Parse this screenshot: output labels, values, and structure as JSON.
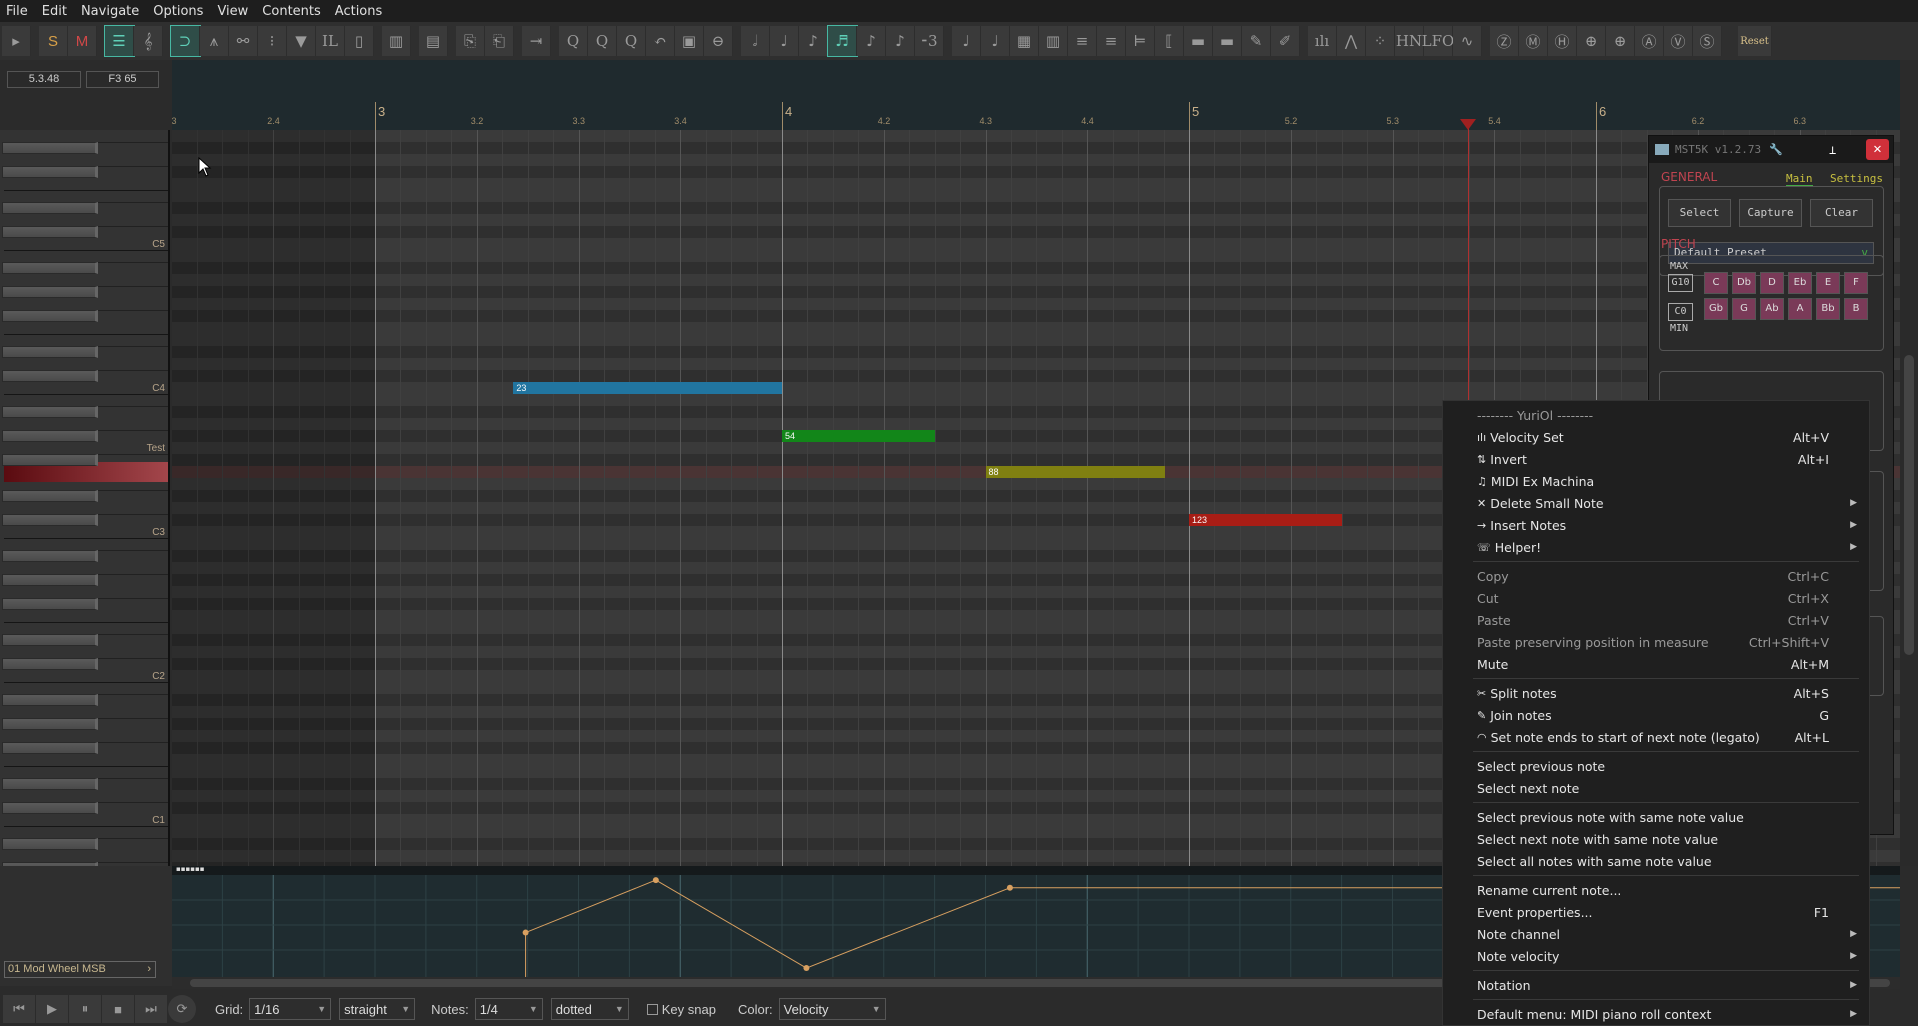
{
  "menubar": [
    "File",
    "Edit",
    "Navigate",
    "Options",
    "View",
    "Contents",
    "Actions"
  ],
  "toolbar": {
    "groups": [
      [
        {
          "icon": "play-arrow-icon",
          "glyph": "▸"
        }
      ],
      [
        {
          "icon": "solo-icon",
          "glyph": "S",
          "cls": "S"
        },
        {
          "icon": "mute-icon",
          "glyph": "M",
          "cls": "M"
        }
      ],
      [
        {
          "icon": "piano-roll-view-icon",
          "glyph": "☰",
          "active": true
        },
        {
          "icon": "treble-clef-icon",
          "glyph": "𝄞"
        }
      ],
      [
        {
          "icon": "snap-magnet-icon",
          "glyph": "⊃",
          "active": true
        },
        {
          "icon": "autoscroll-icon",
          "glyph": "⩚"
        },
        {
          "icon": "link-icon",
          "glyph": "⚯"
        },
        {
          "icon": "footsteps-icon",
          "glyph": "⁝"
        },
        {
          "icon": "filter-icon",
          "glyph": "▼"
        },
        {
          "icon": "IL",
          "glyph": "IL"
        },
        {
          "icon": "velocity-bar-icon",
          "glyph": "▯"
        }
      ],
      [
        {
          "icon": "piano-keys-icon",
          "glyph": "▥"
        }
      ],
      [
        {
          "icon": "cc-lane-icon",
          "glyph": "▤"
        }
      ],
      [
        {
          "icon": "copy-items-icon",
          "glyph": "⎘"
        },
        {
          "icon": "paste-items-icon",
          "glyph": "⎗"
        }
      ],
      [
        {
          "icon": "insert-marker-icon",
          "glyph": "⇥"
        }
      ],
      [
        {
          "icon": "quantize-icon",
          "glyph": "Q"
        },
        {
          "icon": "quantize-settings-icon",
          "glyph": "Q"
        },
        {
          "icon": "unquantize-icon",
          "glyph": "Q"
        },
        {
          "icon": "undo-icon",
          "glyph": "↶"
        },
        {
          "icon": "film-icon",
          "glyph": "▣"
        },
        {
          "icon": "zoom-q-icon",
          "glyph": "⊖"
        }
      ],
      [
        {
          "icon": "half-note-icon",
          "glyph": "𝅗𝅥"
        },
        {
          "icon": "quarter-note-icon",
          "glyph": "♩"
        },
        {
          "icon": "eighth-note-icon",
          "glyph": "♪"
        },
        {
          "icon": "sixteenth-note-icon",
          "glyph": "♬",
          "active": true
        },
        {
          "icon": "thirty-second-note-icon",
          "glyph": "♪"
        },
        {
          "icon": "triplet-note-icon",
          "glyph": "♪"
        },
        {
          "icon": "triplet-grid-icon",
          "glyph": "⁃3"
        }
      ],
      [
        {
          "icon": "legato-icon",
          "glyph": "♩"
        },
        {
          "icon": "staccato-icon",
          "glyph": "♩"
        },
        {
          "icon": "grid-notes-icon",
          "glyph": "▦"
        },
        {
          "icon": "edit-notes-icon",
          "glyph": "▥"
        },
        {
          "icon": "align-left-icon",
          "glyph": "≡"
        },
        {
          "icon": "align-right-icon",
          "glyph": "≡"
        },
        {
          "icon": "align-start-icon",
          "glyph": "⊨"
        },
        {
          "icon": "stretch-icon",
          "glyph": "⟦"
        },
        {
          "icon": "split-red-icon",
          "glyph": "▬"
        },
        {
          "icon": "split-grey-icon",
          "glyph": "▬"
        },
        {
          "icon": "pencil-icon",
          "glyph": "✎"
        },
        {
          "icon": "eraser-icon",
          "glyph": "✐"
        }
      ],
      [
        {
          "icon": "velocity-bars-icon",
          "glyph": "ılı"
        },
        {
          "icon": "node-icon",
          "glyph": "⋀"
        },
        {
          "icon": "dots-icon",
          "glyph": "⁘"
        },
        {
          "icon": "HN",
          "glyph": "HN"
        },
        {
          "icon": "LFO",
          "glyph": "LFO"
        },
        {
          "icon": "sine-pencil-icon",
          "glyph": "∿"
        }
      ],
      [
        {
          "icon": "zoom-z-icon",
          "glyph": "Ⓩ"
        },
        {
          "icon": "zoom-m-icon",
          "glyph": "Ⓜ"
        },
        {
          "icon": "zoom-h-icon",
          "glyph": "Ⓗ"
        },
        {
          "icon": "zoom-down-icon",
          "glyph": "⊕"
        },
        {
          "icon": "zoom-up-icon",
          "glyph": "⊕"
        },
        {
          "icon": "zoom-a-icon",
          "glyph": "Ⓐ"
        },
        {
          "icon": "zoom-v-icon",
          "glyph": "Ⓥ"
        },
        {
          "icon": "zoom-s-icon",
          "glyph": "Ⓢ"
        }
      ],
      [
        {
          "icon": "reset",
          "glyph": "Reset",
          "cls": "reset"
        }
      ]
    ]
  },
  "readouts": {
    "position": "5.3.48",
    "pitch": "F3  65"
  },
  "ruler": {
    "ticks": [
      {
        "label": "3",
        "pos": 2.5
      },
      {
        "label": "2.4",
        "pos": 2.75
      },
      {
        "label": "3",
        "pos": 3,
        "bar": true
      },
      {
        "label": "3.2",
        "pos": 3.25
      },
      {
        "label": "3.3",
        "pos": 3.5
      },
      {
        "label": "3.4",
        "pos": 3.75
      },
      {
        "label": "4",
        "pos": 4,
        "bar": true
      },
      {
        "label": "4.2",
        "pos": 4.25
      },
      {
        "label": "4.3",
        "pos": 4.5
      },
      {
        "label": "4.4",
        "pos": 4.75
      },
      {
        "label": "5",
        "pos": 5,
        "bar": true
      },
      {
        "label": "5.2",
        "pos": 5.25
      },
      {
        "label": "5.3",
        "pos": 5.5
      },
      {
        "label": "5.4",
        "pos": 5.75
      },
      {
        "label": "6",
        "pos": 6,
        "bar": true
      },
      {
        "label": "6.2",
        "pos": 6.25
      },
      {
        "label": "6.3",
        "pos": 6.5
      }
    ],
    "playhead_pos": 5.686
  },
  "keys": {
    "labels": [
      {
        "pitch": 72,
        "label": "C5"
      },
      {
        "pitch": 60,
        "label": "C4"
      },
      {
        "pitch": 55,
        "label": "Test"
      },
      {
        "pitch": 48,
        "label": "C3"
      },
      {
        "pitch": 36,
        "label": "C2"
      },
      {
        "pitch": 24,
        "label": "C1"
      }
    ],
    "highlight_pitch": 53
  },
  "notes": [
    {
      "velocity": "23",
      "pitch": 60,
      "start": 3.34,
      "end": 4.0,
      "color": "#1f6f98"
    },
    {
      "velocity": "54",
      "pitch": 56,
      "start": 4.0,
      "end": 4.375,
      "color": "#118018"
    },
    {
      "velocity": "88",
      "pitch": 53,
      "start": 4.5,
      "end": 4.94,
      "color": "#7a7a10"
    },
    {
      "velocity": "123",
      "pitch": 49,
      "start": 5.0,
      "end": 5.375,
      "color": "#a01c14"
    }
  ],
  "lane": {
    "name": "01 Mod Wheel MSB",
    "points": [
      {
        "pos": 3.37,
        "value": 55
      },
      {
        "pos": 3.69,
        "value": 123
      },
      {
        "pos": 4.06,
        "value": 9
      },
      {
        "pos": 4.56,
        "value": 113
      }
    ],
    "color": "#d8a060"
  },
  "bottombar": {
    "grid_label": "Grid:",
    "grid": "1/16",
    "grid_type": "straight",
    "notes_label": "Notes:",
    "notes": "1/4",
    "notes_type": "dotted",
    "keysnap": "Key snap",
    "color_label": "Color:",
    "color": "Velocity"
  },
  "panel": {
    "title": "MST5K v1.2.73",
    "general": "GENERAL",
    "tab_main": "Main",
    "tab_settings": "Settings",
    "select": "Select",
    "capture": "Capture",
    "clear": "Clear",
    "preset": "Default Preset",
    "pitch": "PITCH",
    "max": "MAX",
    "min": "MIN",
    "max_val": "G10",
    "min_val": "C0",
    "pitch_keys": [
      "C",
      "Db",
      "D",
      "Eb",
      "E",
      "F",
      "Gb",
      "G",
      "Ab",
      "A",
      "Bb",
      "B"
    ]
  },
  "context_menu": {
    "items": [
      {
        "label": "-------- YuriOl --------",
        "header": true
      },
      {
        "icon": "ılı",
        "label": "Velocity Set",
        "shortcut": "Alt+V"
      },
      {
        "icon": "⇅",
        "label": "Invert",
        "shortcut": "Alt+I"
      },
      {
        "icon": "♫",
        "label": "MIDI Ex Machina"
      },
      {
        "icon": "✕",
        "label": "Delete Small Note",
        "submenu": true
      },
      {
        "icon": "→",
        "label": "Insert Notes",
        "submenu": true
      },
      {
        "icon": "☏",
        "label": "Helper!",
        "submenu": true
      },
      {
        "sep": true
      },
      {
        "label": "Copy",
        "shortcut": "Ctrl+C",
        "disabled": true
      },
      {
        "label": "Cut",
        "shortcut": "Ctrl+X",
        "disabled": true
      },
      {
        "label": "Paste",
        "shortcut": "Ctrl+V",
        "disabled": true
      },
      {
        "label": "Paste preserving position in measure",
        "shortcut": "Ctrl+Shift+V",
        "disabled": true
      },
      {
        "label": "Mute",
        "shortcut": "Alt+M"
      },
      {
        "sep": true
      },
      {
        "icon": "✂",
        "label": "Split notes",
        "shortcut": "Alt+S"
      },
      {
        "icon": "✎",
        "label": "Join notes",
        "shortcut": "G"
      },
      {
        "icon": "◠",
        "label": "Set note ends to start of next note (legato)",
        "shortcut": "Alt+L"
      },
      {
        "sep": true
      },
      {
        "label": "Select previous note"
      },
      {
        "label": "Select next note"
      },
      {
        "sep": true
      },
      {
        "label": "Select previous note with same note value"
      },
      {
        "label": "Select next note with same note value"
      },
      {
        "label": "Select all notes with same note value"
      },
      {
        "sep": true
      },
      {
        "label": "Rename current note..."
      },
      {
        "label": "Event properties...",
        "shortcut": "F1"
      },
      {
        "label": "Note channel",
        "submenu": true
      },
      {
        "label": "Note velocity",
        "submenu": true
      },
      {
        "sep": true
      },
      {
        "label": "Notation",
        "submenu": true
      },
      {
        "sep": true
      },
      {
        "label": "Default menu: MIDI piano roll context",
        "submenu": true
      }
    ]
  }
}
